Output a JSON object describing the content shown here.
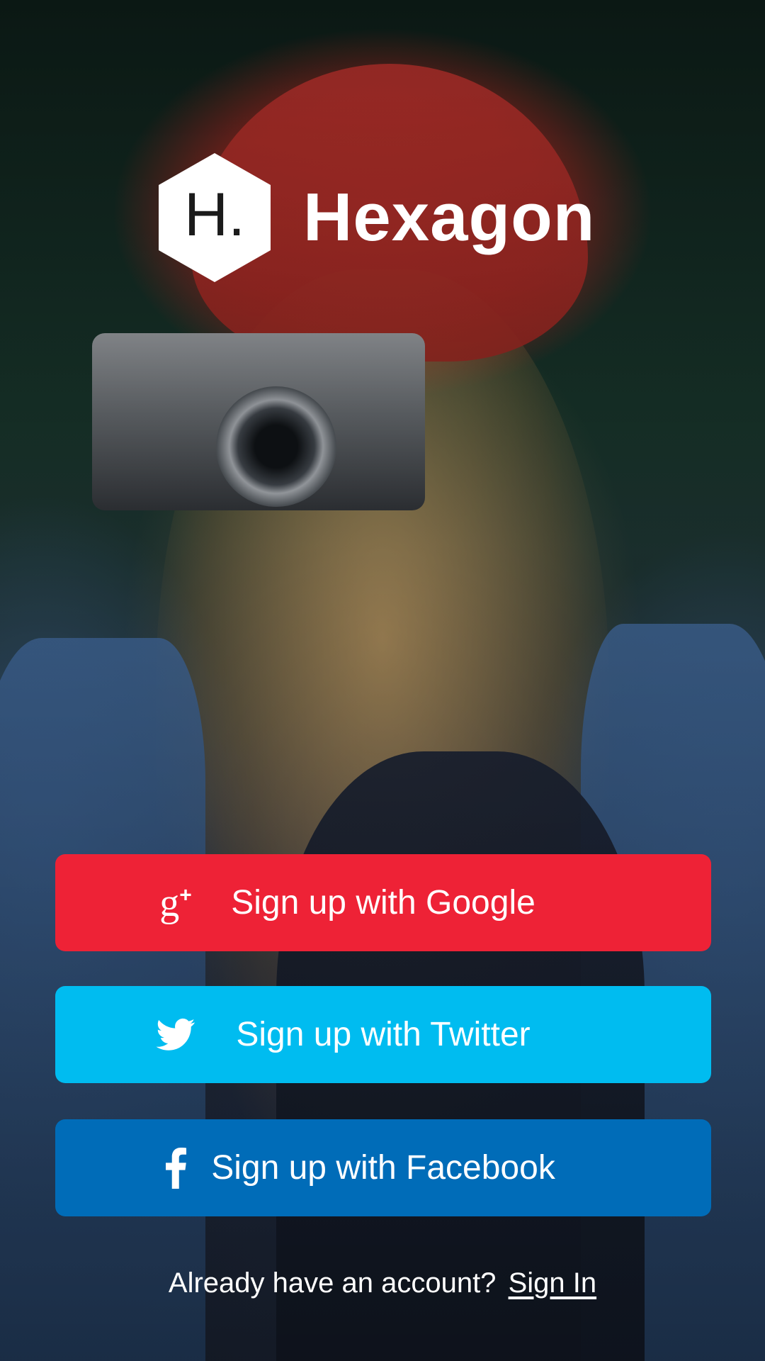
{
  "app": {
    "brand_name": "Hexagon",
    "logo_letter": "H."
  },
  "buttons": {
    "google": {
      "label": "Sign up with Google",
      "icon": "google-plus-icon",
      "color": "#ee2236"
    },
    "twitter": {
      "label": "Sign up with Twitter",
      "icon": "twitter-bird-icon",
      "color": "#00bcf0"
    },
    "facebook": {
      "label": "Sign up with Facebook",
      "icon": "facebook-f-icon",
      "color": "#006cb8"
    }
  },
  "footer": {
    "prompt": "Already have an account?",
    "sign_in_link": "Sign In"
  },
  "background": {
    "description_icon": "photo-background"
  }
}
